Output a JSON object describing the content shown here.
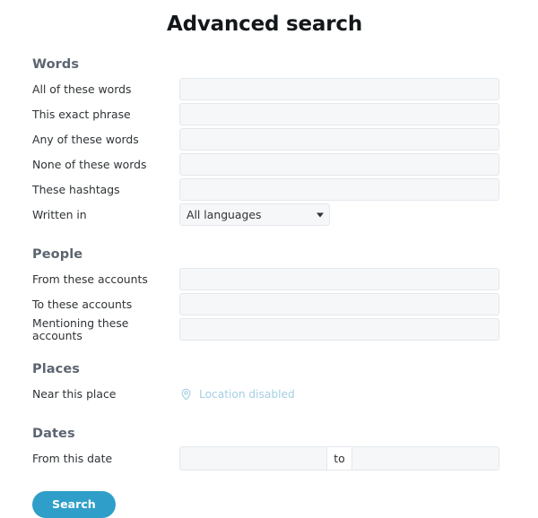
{
  "page": {
    "title": "Advanced search"
  },
  "sections": {
    "words": {
      "heading": "Words",
      "fields": {
        "all_words": {
          "label": "All of these words",
          "value": "",
          "placeholder": ""
        },
        "exact_phrase": {
          "label": "This exact phrase",
          "value": "",
          "placeholder": ""
        },
        "any_words": {
          "label": "Any of these words",
          "value": "",
          "placeholder": ""
        },
        "none_words": {
          "label": "None of these words",
          "value": "",
          "placeholder": ""
        },
        "hashtags": {
          "label": "These hashtags",
          "value": "",
          "placeholder": ""
        },
        "language": {
          "label": "Written in",
          "selected": "All languages",
          "caret_icon": "chevron-down-icon"
        }
      }
    },
    "people": {
      "heading": "People",
      "fields": {
        "from_accounts": {
          "label": "From these accounts",
          "value": "",
          "placeholder": ""
        },
        "to_accounts": {
          "label": "To these accounts",
          "value": "",
          "placeholder": ""
        },
        "mentioning_accounts": {
          "label": "Mentioning these accounts",
          "value": "",
          "placeholder": ""
        }
      }
    },
    "places": {
      "heading": "Places",
      "fields": {
        "near_place": {
          "label": "Near this place",
          "status": "Location disabled",
          "status_icon": "location-pin-icon"
        }
      }
    },
    "dates": {
      "heading": "Dates",
      "fields": {
        "date_range": {
          "label": "From this date",
          "from_value": "",
          "from_placeholder": "",
          "separator": "to",
          "to_value": "",
          "to_placeholder": ""
        }
      }
    }
  },
  "submit": {
    "label": "Search"
  },
  "colors": {
    "accent": "#2f9fc9",
    "heading": "#5b6570",
    "label": "#2f3336",
    "input_bg": "#f5f7f9",
    "input_border": "#e3e8ed",
    "location_disabled": "#a4cfe3",
    "title": "#14171a"
  }
}
